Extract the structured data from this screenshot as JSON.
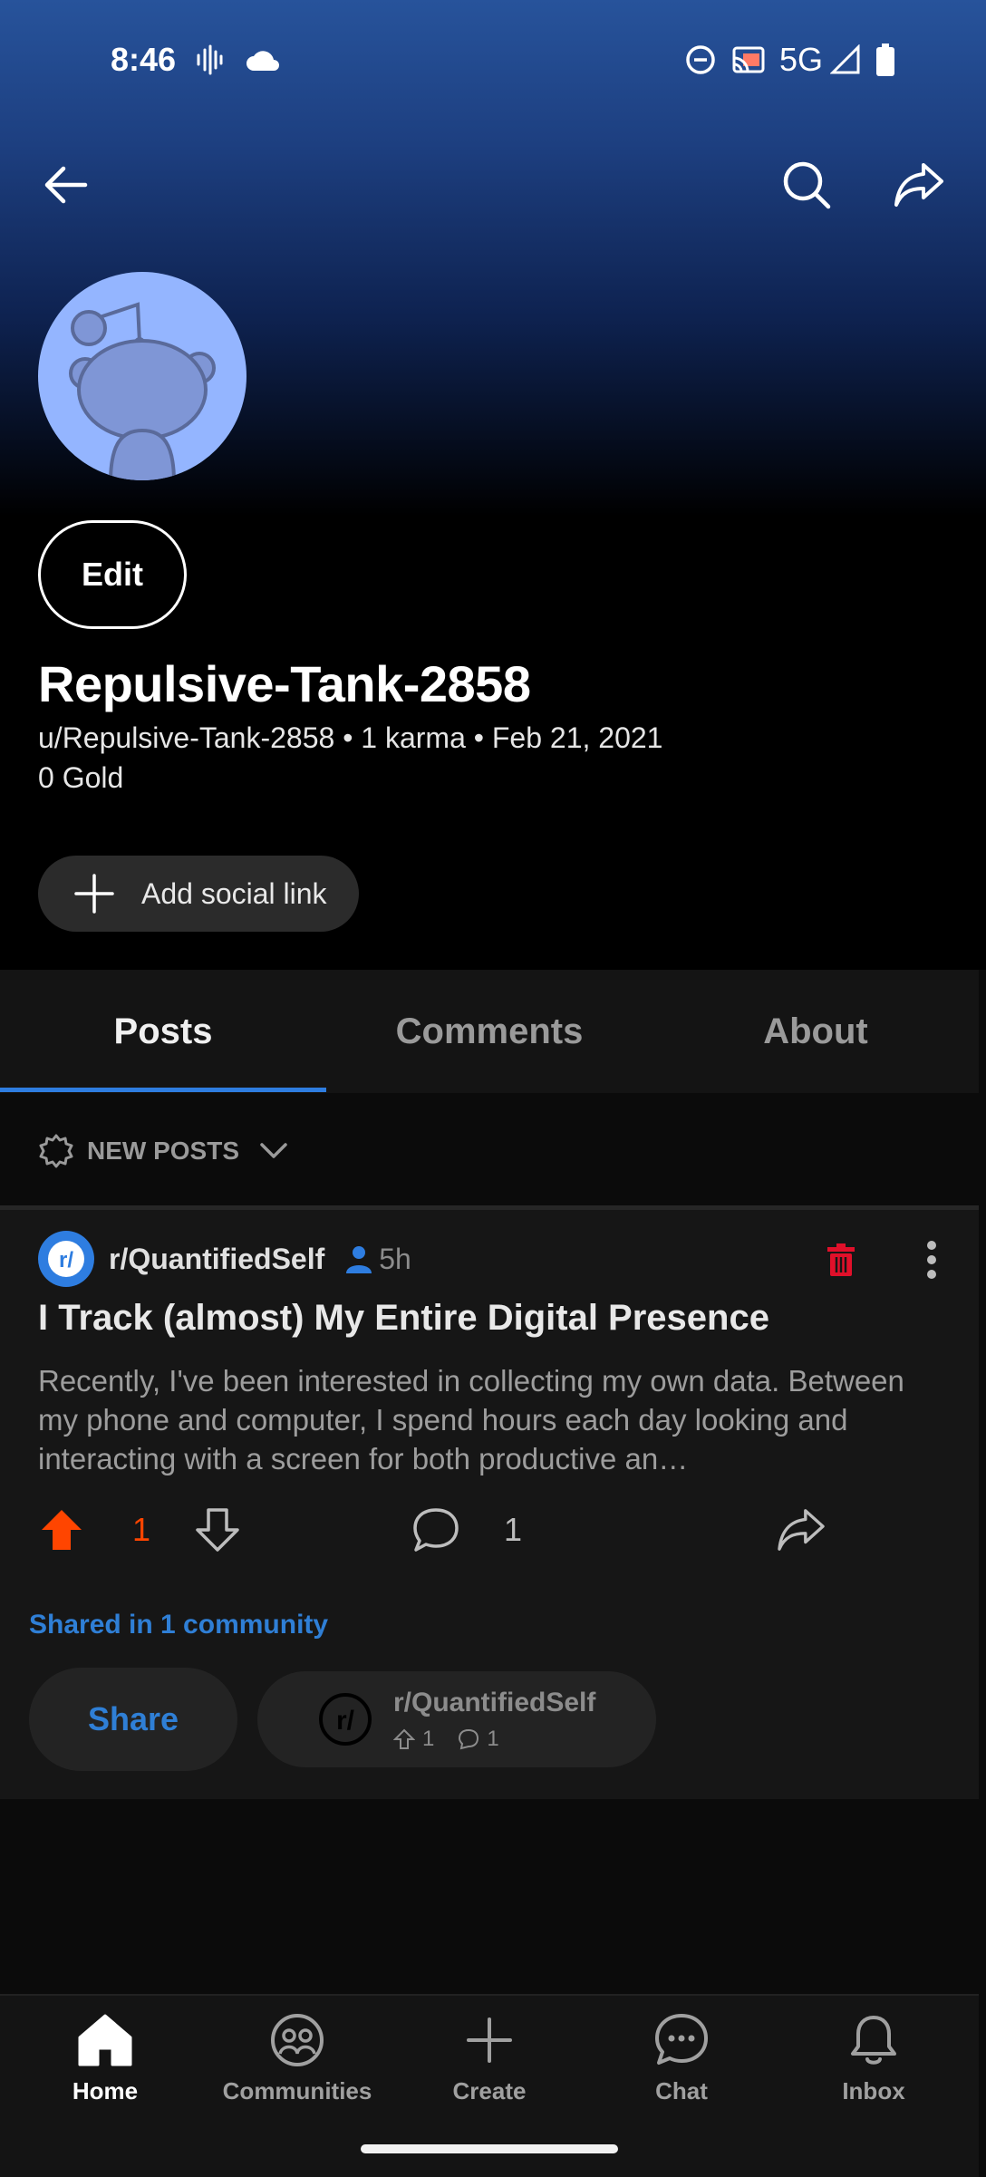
{
  "status_bar": {
    "time": "8:46",
    "network": "5G",
    "icons": [
      "vibrate-icon",
      "cloud-icon",
      "do-not-disturb-icon",
      "cast-icon",
      "signal-icon",
      "battery-icon"
    ]
  },
  "header": {
    "icons": [
      "back-arrow-icon",
      "search-icon",
      "share-icon"
    ]
  },
  "profile": {
    "edit_label": "Edit",
    "display_name": "Repulsive-Tank-2858",
    "meta": "u/Repulsive-Tank-2858 • 1 karma • Feb 21, 2021",
    "gold": "0 Gold",
    "add_social_label": "Add social link",
    "avatar_color": "#94b5ff"
  },
  "tabs": [
    {
      "label": "Posts",
      "active": true
    },
    {
      "label": "Comments",
      "active": false
    },
    {
      "label": "About",
      "active": false
    }
  ],
  "sort": {
    "label": "NEW POSTS"
  },
  "post": {
    "community": "r/QuantifiedSelf",
    "age": "5h",
    "title": "I Track (almost) My Entire Digital Presence",
    "body": "Recently, I've been interested in collecting my own data. Between my phone and computer, I spend hours each day looking and interacting with a screen for both productive an…",
    "upvotes": "1",
    "comments": "1",
    "shared_in": "Shared in 1 community",
    "share_label": "Share",
    "crosspost": {
      "community": "r/QuantifiedSelf",
      "upvotes": "1",
      "comments": "1"
    }
  },
  "bottom_nav": [
    {
      "label": "Home",
      "icon": "home-icon",
      "active": true
    },
    {
      "label": "Communities",
      "icon": "communities-icon",
      "active": false
    },
    {
      "label": "Create",
      "icon": "plus-icon",
      "active": false
    },
    {
      "label": "Chat",
      "icon": "chat-icon",
      "active": false
    },
    {
      "label": "Inbox",
      "icon": "bell-icon",
      "active": false
    }
  ],
  "colors": {
    "accent_blue": "#2e7de0",
    "upvote_orange": "#ff4500",
    "delete_red": "#e0102a",
    "avatar_bg": "#94b5ff"
  }
}
